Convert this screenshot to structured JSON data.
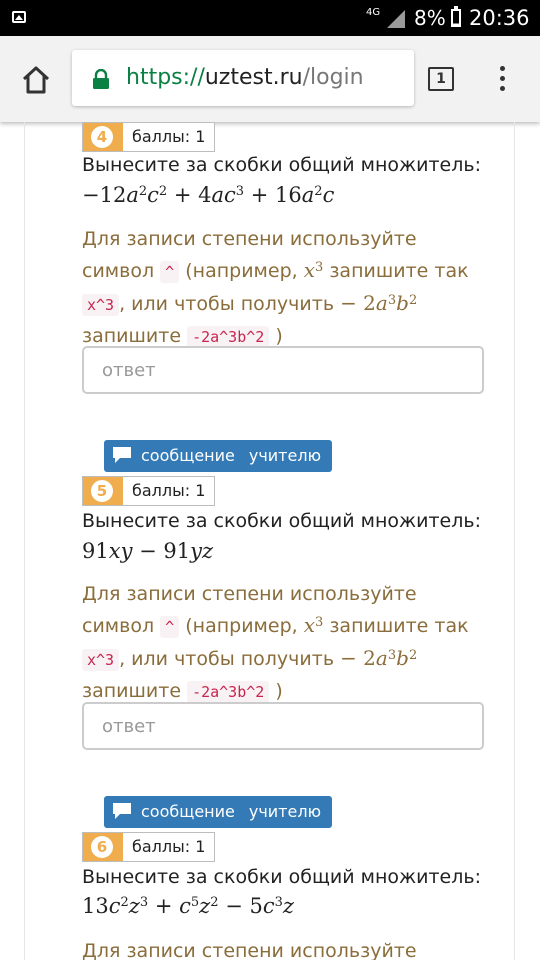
{
  "status_bar": {
    "network": "4G",
    "battery": "8%",
    "time": "20:36"
  },
  "browser": {
    "url_scheme": "https://",
    "url_host": "uztest.ru",
    "url_path": "/login",
    "tab_count": "1"
  },
  "labels": {
    "message_teacher_1": "сообщение",
    "message_teacher_2": "учителю",
    "points": "баллы: 1",
    "task": "Вынесите за скобки общий множитель:",
    "hint_1": "Для записи степени используйте символ",
    "hint_caret": "^",
    "hint_2": "(например,",
    "hint_3": "запишите так",
    "hint_x3": "x^3",
    "hint_4": ", или",
    "hint_5": "чтобы получить",
    "hint_6": "запишите",
    "hint_example": "-2a^3b^2",
    "hint_close": ")",
    "answer_placeholder": "ответ"
  },
  "questions": [
    {
      "number": "4",
      "expression": "−12a²c² + 4ac³ + 16a²c"
    },
    {
      "number": "5",
      "expression": "91xy − 91yz"
    },
    {
      "number": "6",
      "expression": "13c²z³ + c⁵z² − 5c³z"
    }
  ],
  "colors": {
    "accent": "#337ab7",
    "badge": "#f0ad4e",
    "hint_text": "#8a6d3b",
    "code": "#c7254e",
    "secure": "#0b8043"
  }
}
